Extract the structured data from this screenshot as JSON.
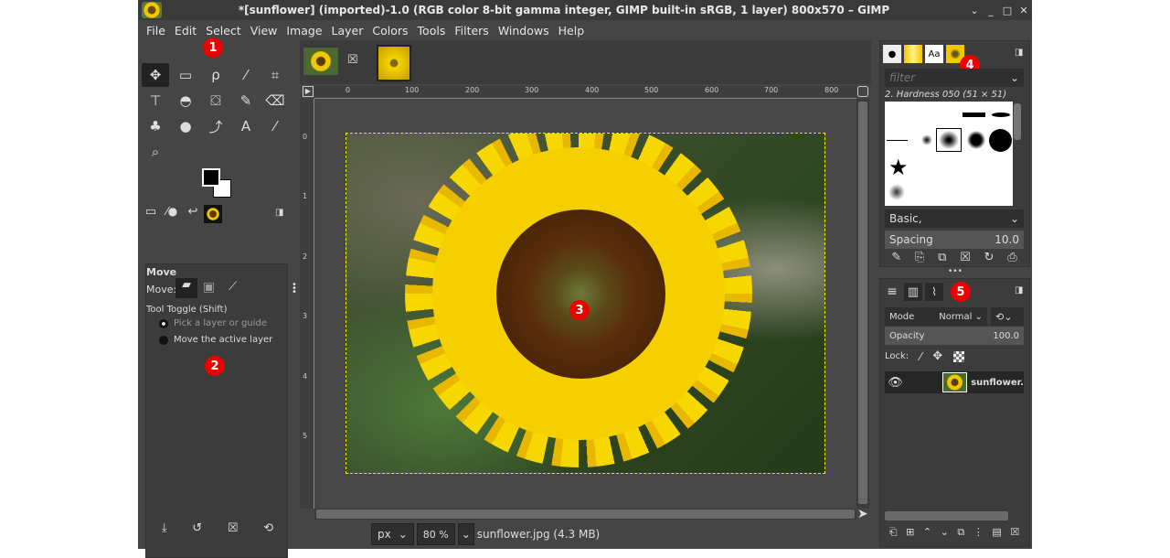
{
  "window": {
    "title": "*[sunflower] (imported)-1.0 (RGB color 8-bit gamma integer, GIMP built-in sRGB, 1 layer) 800x570 – GIMP",
    "controls": [
      "⌄",
      "_",
      "□",
      "✕"
    ]
  },
  "menu": [
    "File",
    "Edit",
    "Select",
    "View",
    "Image",
    "Layer",
    "Colors",
    "Tools",
    "Filters",
    "Windows",
    "Help"
  ],
  "badges": [
    "1",
    "2",
    "3",
    "4",
    "5"
  ],
  "tools": [
    {
      "name": "move",
      "glyph": "✥"
    },
    {
      "name": "rect-select",
      "glyph": "▭"
    },
    {
      "name": "lasso",
      "glyph": "ρ"
    },
    {
      "name": "fuzzy-select",
      "glyph": "⁄"
    },
    {
      "name": "crop",
      "glyph": "⌗"
    },
    {
      "name": "transform",
      "glyph": "⊤"
    },
    {
      "name": "warp",
      "glyph": "◓"
    },
    {
      "name": "bucket-fill",
      "glyph": "⛋"
    },
    {
      "name": "paintbrush",
      "glyph": "✎"
    },
    {
      "name": "eraser",
      "glyph": "⌫"
    },
    {
      "name": "clone",
      "glyph": "♣"
    },
    {
      "name": "smudge",
      "glyph": "●"
    },
    {
      "name": "paths",
      "glyph": "⤴"
    },
    {
      "name": "text",
      "glyph": "A"
    },
    {
      "name": "color-picker",
      "glyph": "⁄"
    },
    {
      "name": "zoom",
      "glyph": "⌕"
    }
  ],
  "tool_options": {
    "title": "Move",
    "move_label": "Move:",
    "toggle_label": "Tool Toggle  (Shift)",
    "options": [
      {
        "label": "Pick a layer or guide",
        "selected": true
      },
      {
        "label": "Move the active layer",
        "selected": false
      }
    ],
    "bottom_icons": [
      "save",
      "restore",
      "delete",
      "reset"
    ]
  },
  "canvas": {
    "ruler_ticks": [
      "0",
      "100",
      "200",
      "300",
      "400",
      "500",
      "600",
      "700",
      "800"
    ],
    "vruler_ticks": [
      "0",
      "1",
      "2",
      "3",
      "4",
      "5"
    ],
    "unit": "px",
    "zoom": "80 %",
    "status": "sunflower.jpg (4.3  MB)"
  },
  "brushes": {
    "filter_placeholder": "filter",
    "brush_name": "2. Hardness 050 (51 × 51)",
    "tag": "Basic,",
    "spacing_label": "Spacing",
    "spacing_value": "10.0"
  },
  "layers": {
    "mode_label": "Mode",
    "mode_value": "Normal",
    "opacity_label": "Opacity",
    "opacity_value": "100.0",
    "lock_label": "Lock:",
    "items": [
      {
        "name": "sunflower.",
        "visible": true
      }
    ]
  },
  "colors": {
    "accent_badge": "#e00000",
    "bg": "#454545",
    "fg_color": "#000000",
    "bg_color": "#ffffff"
  }
}
